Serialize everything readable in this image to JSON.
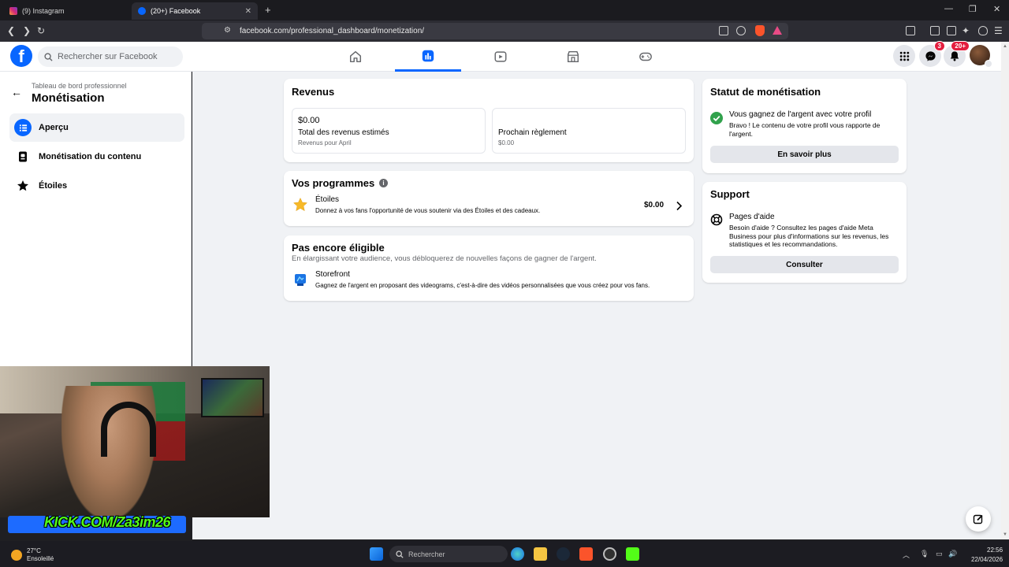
{
  "browser": {
    "tabs": [
      {
        "title": "(9) Instagram",
        "active": false
      },
      {
        "title": "(20+) Facebook",
        "active": true
      }
    ],
    "new_tab": "+",
    "url": "facebook.com/professional_dashboard/monetization/"
  },
  "header": {
    "logo": "f",
    "search_placeholder": "Rechercher sur Facebook",
    "nav": [
      "home-icon",
      "dashboard-icon",
      "video-icon",
      "marketplace-icon",
      "gaming-icon"
    ],
    "messenger_badge": "3",
    "notifications_badge": "20+"
  },
  "sidebar": {
    "subtitle": "Tableau de bord professionnel",
    "title": "Monétisation",
    "items": [
      {
        "label": "Aperçu",
        "icon": "overview-icon",
        "active": true
      },
      {
        "label": "Monétisation du contenu",
        "icon": "content-monetization-icon",
        "active": false
      },
      {
        "label": "Étoiles",
        "icon": "stars-icon",
        "active": false
      }
    ]
  },
  "revenue": {
    "title": "Revenus",
    "estimated": {
      "amount": "$0.00",
      "label": "Total des revenus estimés",
      "sub": "Revenus pour April"
    },
    "next": {
      "label": "Prochain règlement",
      "amount": "$0.00"
    }
  },
  "programs": {
    "title": "Vos programmes",
    "items": [
      {
        "name": "Étoiles",
        "desc": "Donnez à vos fans l'opportunité de vous soutenir via des Étoiles et des cadeaux.",
        "amount": "$0.00"
      }
    ]
  },
  "not_eligible": {
    "title": "Pas encore éligible",
    "subtitle": "En élargissant votre audience, vous débloquerez de nouvelles façons de gagner de l'argent.",
    "items": [
      {
        "name": "Storefront",
        "desc": "Gagnez de l'argent en proposant des videograms, c'est-à-dire des vidéos personnalisées que vous créez pour vos fans."
      }
    ]
  },
  "status": {
    "title": "Statut de monétisation",
    "headline": "Vous gagnez de l'argent avec votre profil",
    "desc": "Bravo ! Le contenu de votre profil vous rapporte de l'argent.",
    "button": "En savoir plus"
  },
  "support": {
    "title": "Support",
    "item_title": "Pages d'aide",
    "item_desc": "Besoin d'aide ? Consultez les pages d'aide Meta Business pour plus d'informations sur les revenus, les statistiques et les recommandations.",
    "button": "Consulter"
  },
  "overlay": {
    "kick_text": "KICK.COM/Za3im26"
  },
  "taskbar": {
    "temp": "27°C",
    "weather": "Ensoleillé",
    "search_placeholder": "Rechercher",
    "time": "22:56",
    "date": "22/04/2026"
  },
  "colors": {
    "fb_blue": "#0866ff",
    "success_green": "#31a24c",
    "page_bg": "#f0f2f5",
    "kick_green": "#53fc18"
  }
}
